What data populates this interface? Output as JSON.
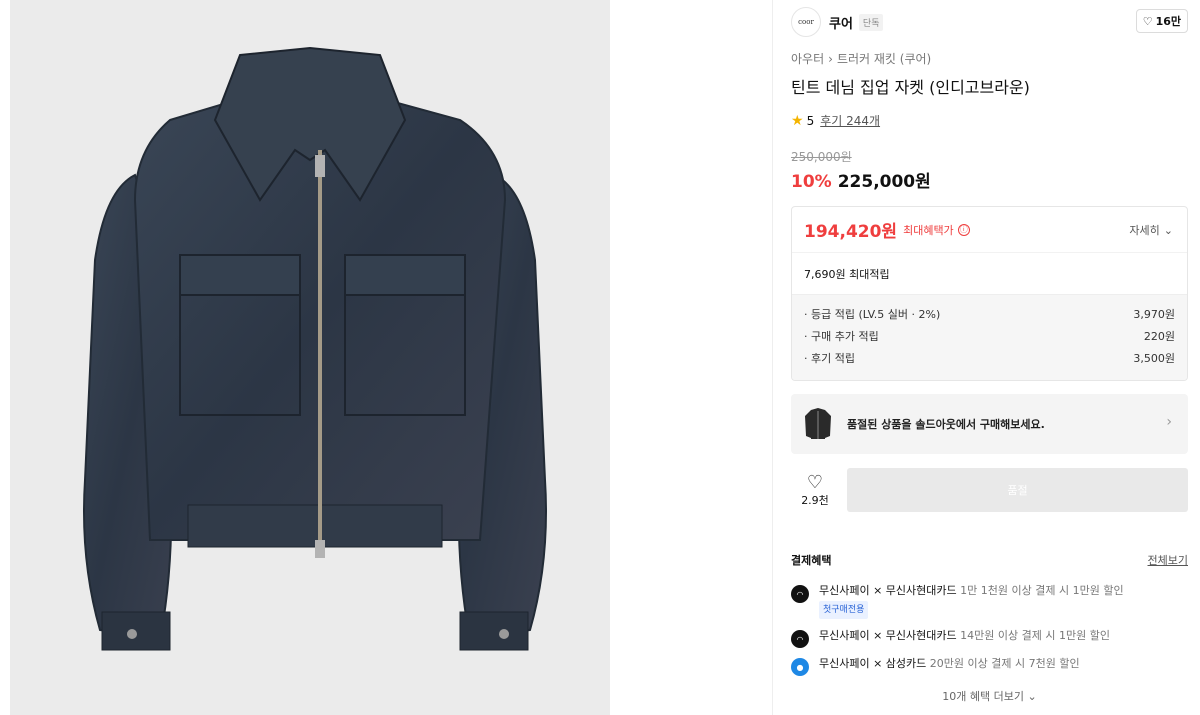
{
  "brand": {
    "logo_text": "coor",
    "name": "쿠어",
    "badge": "단독",
    "like_count": "16만"
  },
  "breadcrumb": {
    "level1": "아우터",
    "separator": "›",
    "level2": "트러커 재킷 (쿠어)"
  },
  "product": {
    "title": "틴트 데님 집업 자켓 (인디고브라운)",
    "rating": "5",
    "review_text": "후기 244개",
    "original_price": "250,000원",
    "discount_rate": "10%",
    "sale_price": "225,000원"
  },
  "benefit": {
    "max_price": "194,420원",
    "max_label": "최대혜택가",
    "info_icon": "ⓘ",
    "detail_label": "자세히",
    "points_total": "7,690원 최대적립",
    "items": [
      {
        "label": "· 등급 적립 (LV.5 실버 · 2%)",
        "value": "3,970원"
      },
      {
        "label": "· 구매 추가 적립",
        "value": "220원"
      },
      {
        "label": "· 후기 적립",
        "value": "3,500원"
      }
    ]
  },
  "soldout": {
    "text": "품절된 상품을 솔드아웃에서 구매해보세요."
  },
  "actions": {
    "wish_count": "2.9천",
    "buy_label": "품절"
  },
  "payment": {
    "title": "결제혜택",
    "view_all": "전체보기",
    "items": [
      {
        "card": "무신사페이 × 무신사현대카드",
        "desc": "1만 1천원 이상 결제 시 1만원 할인",
        "tag": "첫구매전용"
      },
      {
        "card": "무신사페이 × 무신사현대카드",
        "desc": "14만원 이상 결제 시 1만원 할인",
        "tag": ""
      },
      {
        "card": "무신사페이 × 삼성카드",
        "desc": "20만원 이상 결제 시 7천원 할인",
        "tag": ""
      }
    ],
    "more": "10개 혜택 더보기 ⌄"
  },
  "colors": {
    "accent_red": "#ef3e3e",
    "star": "#f4b400",
    "denim": "#2f3a4a",
    "photo_bg": "#ebebeb"
  }
}
